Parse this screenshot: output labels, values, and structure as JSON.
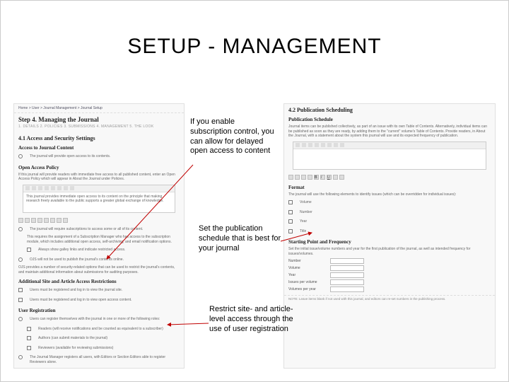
{
  "title": "SETUP - MANAGEMENT",
  "callouts": {
    "c1": "If you enable subscription control, you can allow for delayed open access to content",
    "c2": "Set the publication schedule that is best for your journal",
    "c3": "Restrict site- and article-level access through the use of user registration"
  },
  "left": {
    "crumbs": "Home > User > Journal Management > Journal Setup",
    "h1": "Step 4. Managing the Journal",
    "tabs": "1. DETAILS  2. POLICIES  3. SUBMISSIONS  4. MANAGEMENT  5. THE LOOK",
    "s41": "4.1 Access and Security Settings",
    "s41a": "Access to Journal Content",
    "s41a_desc": "The journal will provide open access to its contents.",
    "oap": "Open Access Policy",
    "oap_desc": "If this journal will provide readers with immediate free access to all published content, enter an Open Access Policy which will appear in About the Journal under Policies.",
    "oap_box": "This journal provides immediate open access to its content on the principle that making research freely available to the public supports a greater global exchange of knowledge.",
    "sub_desc": "The journal will require subscriptions to access some or all of its content.",
    "sub_desc2": "This requires the assignment of a Subscription Manager who has access to the subscription module, which includes additional open access, self-archiving, and email notification options.",
    "sub_opt1": "Always show galley links and indicate restricted access.",
    "sub_opt2": "OJS will not be used to publish the journal's contents online.",
    "sub_note": "OJS provides a number of security-related options that can be used to restrict the journal's contents, and maintain additional information about submissions for auditing purposes.",
    "asaar": "Additional Site and Article Access Restrictions",
    "asaar_opt1": "Users must be registered and log in to view the journal site.",
    "asaar_opt2": "Users must be registered and log in to view open access content.",
    "ur": "User Registration",
    "ur_desc": "Users can register themselves with the journal in one or more of the following roles:",
    "ur_opt1": "Readers (will receive notifications and be counted as equivalent to a subscriber)",
    "ur_opt2": "Authors (can submit materials to the journal)",
    "ur_opt3": "Reviewers (available for reviewing submissions)",
    "ur_jm": "The Journal Manager registers all users, with Editors or Section Editors able to register Reviewers alone."
  },
  "right": {
    "s42": "4.2 Publication Scheduling",
    "ps": "Publication Schedule",
    "ps_desc": "Journal items can be published collectively, as part of an issue with its own Table of Contents. Alternatively, individual items can be published as soon as they are ready, by adding them to the \"current\" volume's Table of Contents. Provide readers, in About the Journal, with a statement about the system this journal will use and its expected frequency of publication.",
    "fmt": "Format",
    "fmt_desc": "The journal will use the following elements to identify issues (which can be overridden for individual issues):",
    "fmt_vol": "Volume",
    "fmt_num": "Number",
    "fmt_year": "Year",
    "fmt_title": "Title",
    "spf": "Starting Point and Frequency",
    "spf_desc": "Set the initial issue/volume numbers and year for the first publication of the journal, as well as intended frequency for issues/volumes.",
    "f_number": "Number",
    "f_volume": "Volume",
    "f_year": "Year",
    "f_ipv": "Issues per volume",
    "f_vpy": "Volumes per year",
    "note": "NOTE: Leave items blank if not used with this journal, and editors can re-set numbers in the publishing process."
  }
}
